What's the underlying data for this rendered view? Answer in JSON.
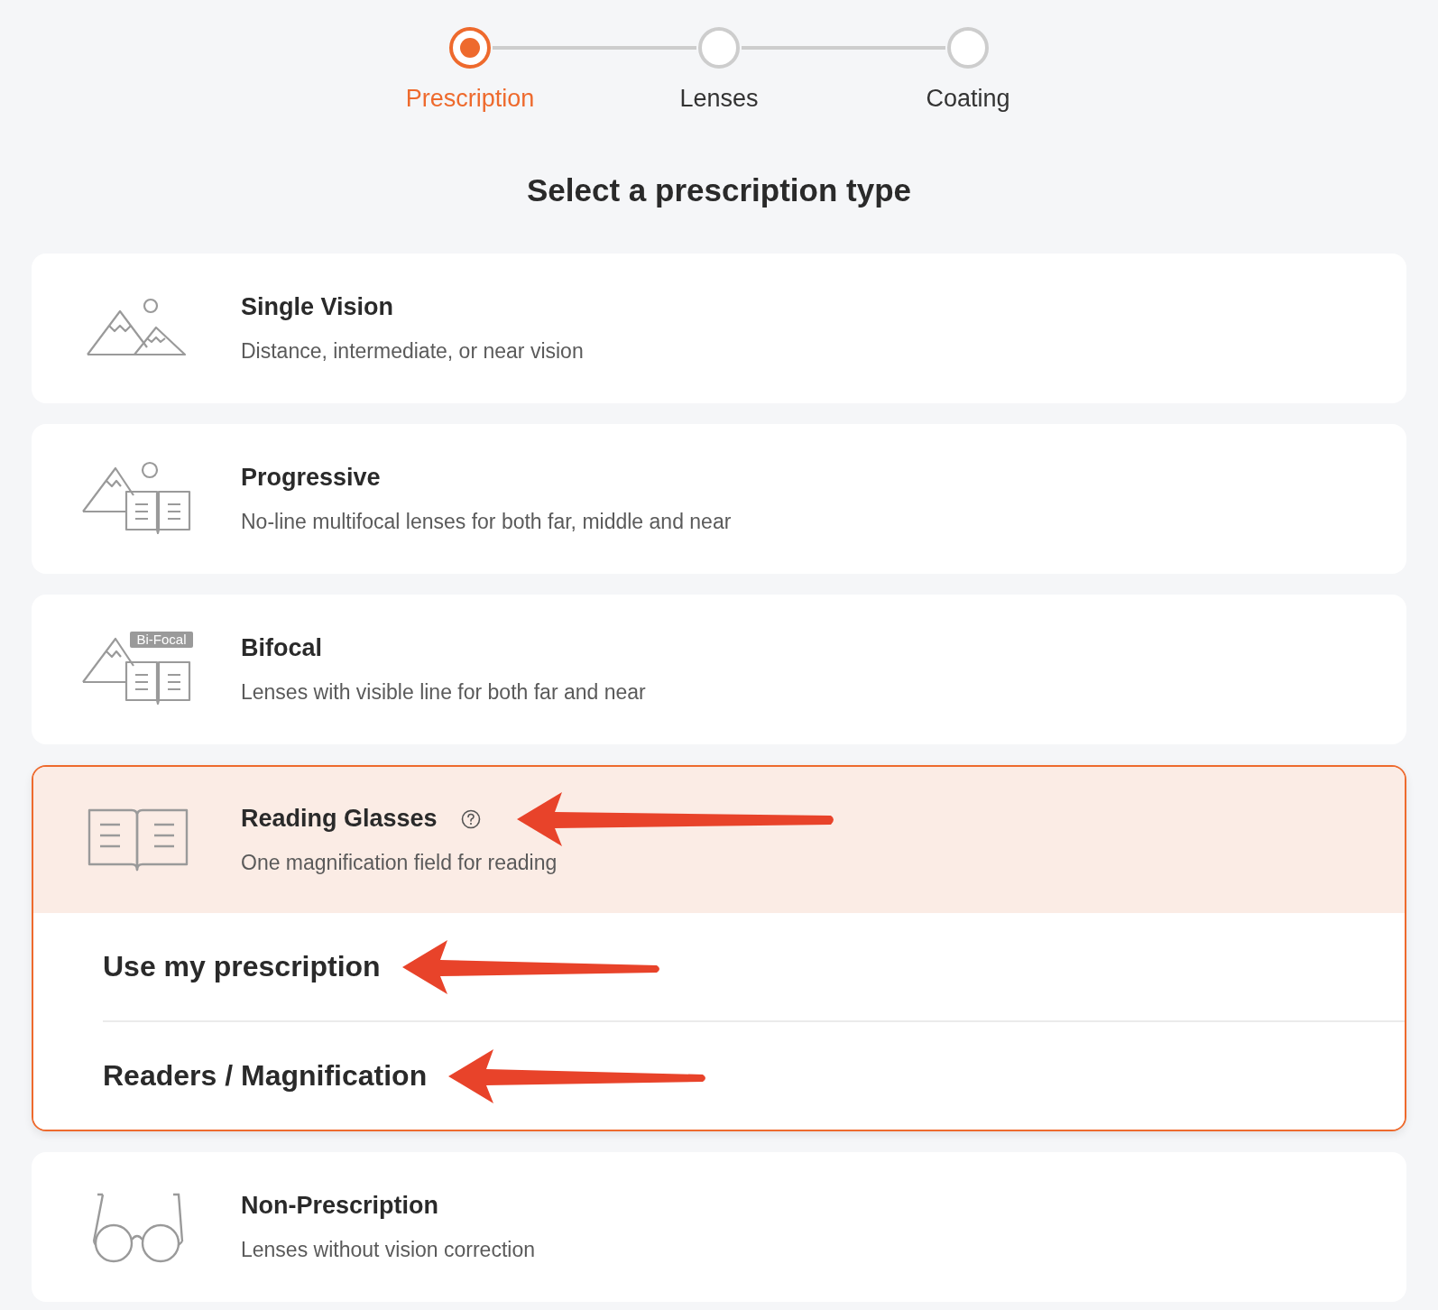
{
  "stepper": [
    {
      "label": "Prescription",
      "selected": true
    },
    {
      "label": "Lenses",
      "selected": false
    },
    {
      "label": "Coating",
      "selected": false
    }
  ],
  "heading": "Select a prescription type",
  "options": [
    {
      "kind": "mountains",
      "title": "Single Vision",
      "description": "Distance, intermediate, or near vision",
      "selected": false
    },
    {
      "kind": "mountains-book",
      "title": "Progressive",
      "description": "No-line multifocal lenses for both far, middle and near",
      "selected": false
    },
    {
      "kind": "bifocal",
      "badge": "Bi-Focal",
      "title": "Bifocal",
      "description": "Lenses with visible line for both far and near",
      "selected": false
    },
    {
      "kind": "book",
      "title": "Reading Glasses",
      "help_icon": true,
      "arrow": true,
      "description": "One magnification field for reading",
      "selected": true,
      "expanded": true,
      "sub_options": [
        {
          "label": "Use my prescription",
          "arrow": true
        },
        {
          "label": "Readers / Magnification",
          "arrow": true
        }
      ]
    },
    {
      "kind": "glasses",
      "title": "Non-Prescription",
      "description": "Lenses without vision correction",
      "selected": false
    }
  ]
}
